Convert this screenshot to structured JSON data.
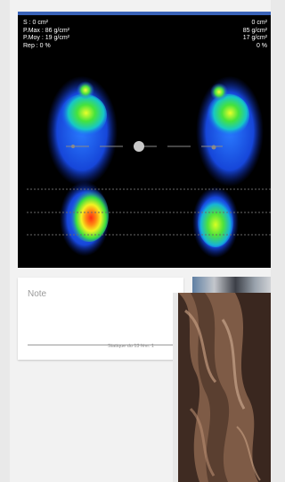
{
  "stats_left": {
    "surface": "S : 0 cm²",
    "pmax": "P.Max : 86 g/cm²",
    "pmoy": "P.Moy : 19 g/cm²",
    "rep": "Rep : 0 %"
  },
  "stats_right": {
    "surface": "0 cm²",
    "pmax": "85 g/cm²",
    "pmoy": "17 g/cm²",
    "rep": "0 %"
  },
  "note": {
    "label": "Note"
  },
  "caption": "Statique du 13 févr. 1",
  "colors": {
    "accent": "#3a63b8",
    "scan_bg": "#000000",
    "pressure_low": "#1e6bff",
    "pressure_mid": "#35e24a",
    "pressure_high": "#ffe000",
    "pressure_peak": "#e8231d"
  },
  "icons": {
    "center_of_pressure": "cop-dot-icon"
  }
}
